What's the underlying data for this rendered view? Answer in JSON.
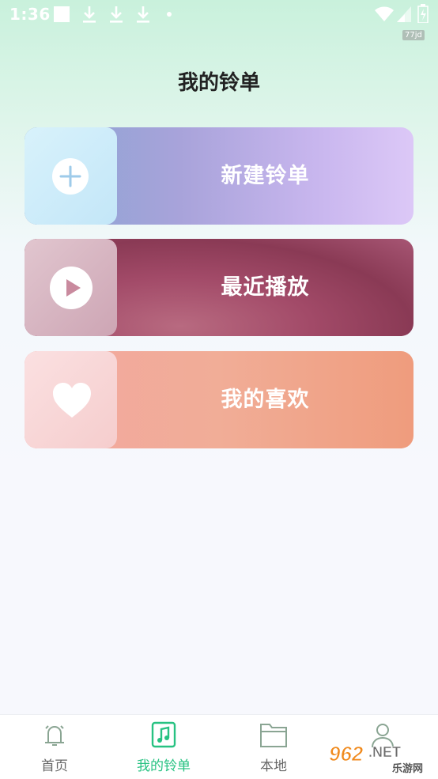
{
  "status_bar": {
    "time": "1:36"
  },
  "badge": "77jd",
  "page_title": "我的铃单",
  "cards": [
    {
      "label": "新建铃单",
      "icon": "plus-icon"
    },
    {
      "label": "最近播放",
      "icon": "play-icon"
    },
    {
      "label": "我的喜欢",
      "icon": "heart-icon"
    }
  ],
  "tabs": [
    {
      "label": "首页",
      "icon": "bell-icon",
      "active": false
    },
    {
      "label": "我的铃单",
      "icon": "music-note-icon",
      "active": true
    },
    {
      "label": "本地",
      "icon": "folder-icon",
      "active": false
    },
    {
      "label": "",
      "icon": "user-icon",
      "active": false
    }
  ],
  "watermark": {
    "text1": "962",
    "text2": ".NET",
    "text3": "乐游网"
  },
  "colors": {
    "accent": "#27c282",
    "title": "#222222"
  }
}
